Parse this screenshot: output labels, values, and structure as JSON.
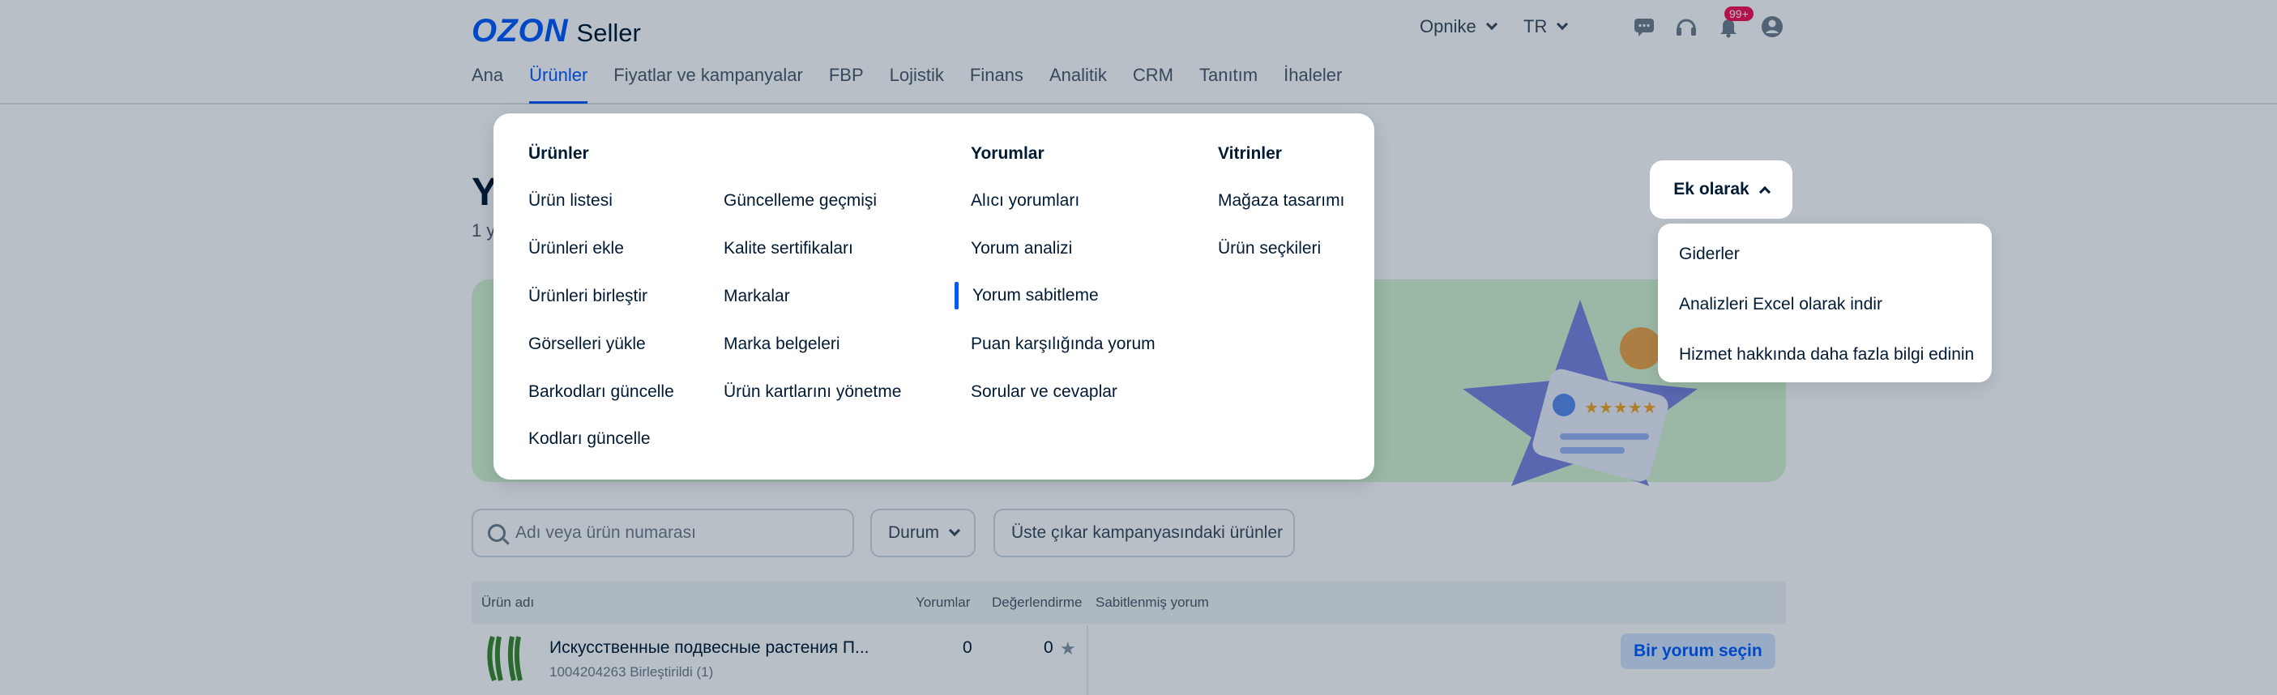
{
  "header": {
    "logo_brand": "OZON",
    "logo_product": "Seller",
    "store_selector": "Opnike",
    "language_selector": "TR",
    "notification_badge": "99+"
  },
  "nav": {
    "items": [
      "Ana",
      "Ürünler",
      "Fiyatlar ve kampanyalar",
      "FBP",
      "Lojistik",
      "Finans",
      "Analitik",
      "CRM",
      "Tanıtım",
      "İhaleler"
    ],
    "active": "Ürünler"
  },
  "page": {
    "title": "Y",
    "subtitle": "1 y"
  },
  "mega_menu": {
    "col_products": {
      "heading": "Ürünler",
      "items_a": [
        "Ürün listesi",
        "Ürünleri ekle",
        "Ürünleri birleştir",
        "Görselleri yükle",
        "Barkodları güncelle",
        "Kodları güncelle"
      ],
      "items_b": [
        "Güncelleme geçmişi",
        "Kalite sertifikaları",
        "Markalar",
        "Marka belgeleri",
        "Ürün kartlarını yönetme"
      ]
    },
    "col_reviews": {
      "heading": "Yorumlar",
      "items": [
        "Alıcı yorumları",
        "Yorum analizi",
        "Yorum sabitleme",
        "Puan karşılığında yorum",
        "Sorular ve cevaplar"
      ],
      "selected": "Yorum sabitleme"
    },
    "col_showcases": {
      "heading": "Vitrinler",
      "items": [
        "Mağaza tasarımı",
        "Ürün seçkileri"
      ]
    }
  },
  "extra": {
    "button_label": "Ek olarak",
    "dropdown": [
      "Giderler",
      "Analizleri Excel olarak indir",
      "Hizmet hakkında daha fazla bilgi edinin"
    ],
    "highlighted": "Analizleri Excel olarak indir"
  },
  "filters": {
    "search_placeholder": "Adı veya ürün numarası",
    "status_label": "Durum",
    "promo_label": "Üste çıkar kampanyasındaki ürünler"
  },
  "table": {
    "headers": [
      "Ürün adı",
      "Yorumlar",
      "Değerlendirme",
      "Sabitlenmiş yorum"
    ],
    "rows": [
      {
        "name": "Искусственные подвесные растения П...",
        "id": "1004204263 Birleştirildi (1)",
        "reviews": "0",
        "rating": "0",
        "action": "Bir yorum seçin"
      }
    ]
  },
  "colors": {
    "brand": "#005bff",
    "badge": "#f91155",
    "banner": "#d6f5d2"
  }
}
